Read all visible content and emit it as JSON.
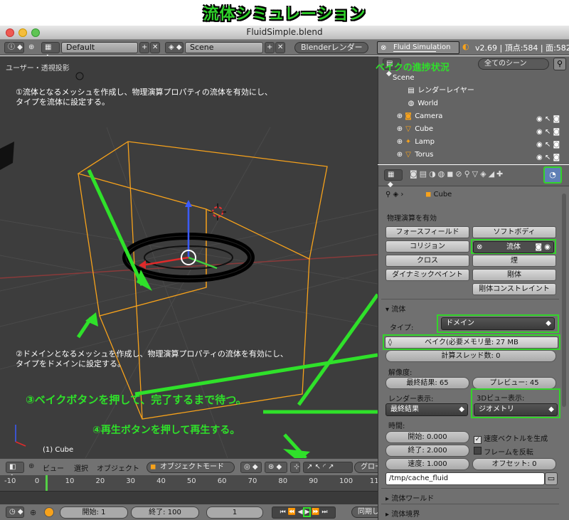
{
  "banner": {
    "title": "流体シミュレーション"
  },
  "window": {
    "file_title": "FluidSimple.blend"
  },
  "header": {
    "layout": "Default",
    "scene": "Scene",
    "engine": "Blenderレンダー",
    "stats": "v2.69 | 頂点:584 | 面:582 |",
    "fluid_sim_label": "Fluid Simulation"
  },
  "viewport": {
    "label": "ユーザー・透視投影",
    "object_label": "(1) Cube",
    "toolbar": {
      "view": "ビュー",
      "select": "選択",
      "object": "オブジェクト",
      "mode": "オブジェクトモード",
      "global": "グロー"
    }
  },
  "timeline": {
    "ticks": [
      "-10",
      "0",
      "10",
      "20",
      "30",
      "40",
      "50",
      "60",
      "70",
      "80",
      "90",
      "100",
      "11"
    ],
    "start": "開始: 1",
    "end": "終了: 100",
    "current": "1",
    "sync": "同期し"
  },
  "outliner": {
    "filter": "全てのシーン",
    "items": [
      "Scene",
      "レンダーレイヤー",
      "World",
      "Camera",
      "Cube",
      "Lamp",
      "Torus"
    ]
  },
  "props": {
    "object": "Cube",
    "physics_enable": "物理演算を有効",
    "buttons": {
      "force_field": "フォースフィールド",
      "soft_body": "ソフトボディ",
      "collision": "コリジョン",
      "fluid": "流体",
      "cloth": "クロス",
      "smoke": "煙",
      "dynamic_paint": "ダイナミックペイント",
      "rigid_body": "剛体",
      "rigid_constraint": "剛体コンストレイント"
    },
    "fluid_panel": "流体",
    "type_label": "タイプ:",
    "type_value": "ドメイン",
    "bake": "ベイク(必要メモリ量: 27 MB",
    "threads": "計算スレッド数: 0",
    "resolution_label": "解像度:",
    "final_res": "最終結果: 65",
    "preview_res": "プレビュー: 45",
    "render_display_label": "レンダー表示:",
    "view3d_display_label": "3Dビュー表示:",
    "render_display": "最終結果",
    "view3d_display": "ジオメトリ",
    "time_label": "時間:",
    "start": "開始: 0.000",
    "end": "終了: 2.000",
    "speed": "速度: 1.000",
    "gen_speed_vectors": "速度ベクトルを生成",
    "reverse_frames": "フレームを反転",
    "offset": "オフセット: 0",
    "cache_path": "/tmp/cache_fluid",
    "fluid_world": "流体ワールド",
    "fluid_boundary": "流体境界"
  },
  "annotations": {
    "bake_progress": "ベイクの進捗状況",
    "step1_l1": "①流体となるメッシュを作成し、物理演算プロパティの流体を有効にし、",
    "step1_l2": "タイプを流体に設定する。",
    "step2_l1": "②ドメインとなるメッシュを作成し、物理演算プロパティの流体を有効にし、",
    "step2_l2": "タイプをドメインに設定する。",
    "step3": "③ベイクボタンを押して、完了するまで待つ。",
    "step4": "④再生ボタンを押して再生する。"
  },
  "colors": {
    "annotation_green": "#2fe12a",
    "selection_orange": "#f7a21b"
  }
}
